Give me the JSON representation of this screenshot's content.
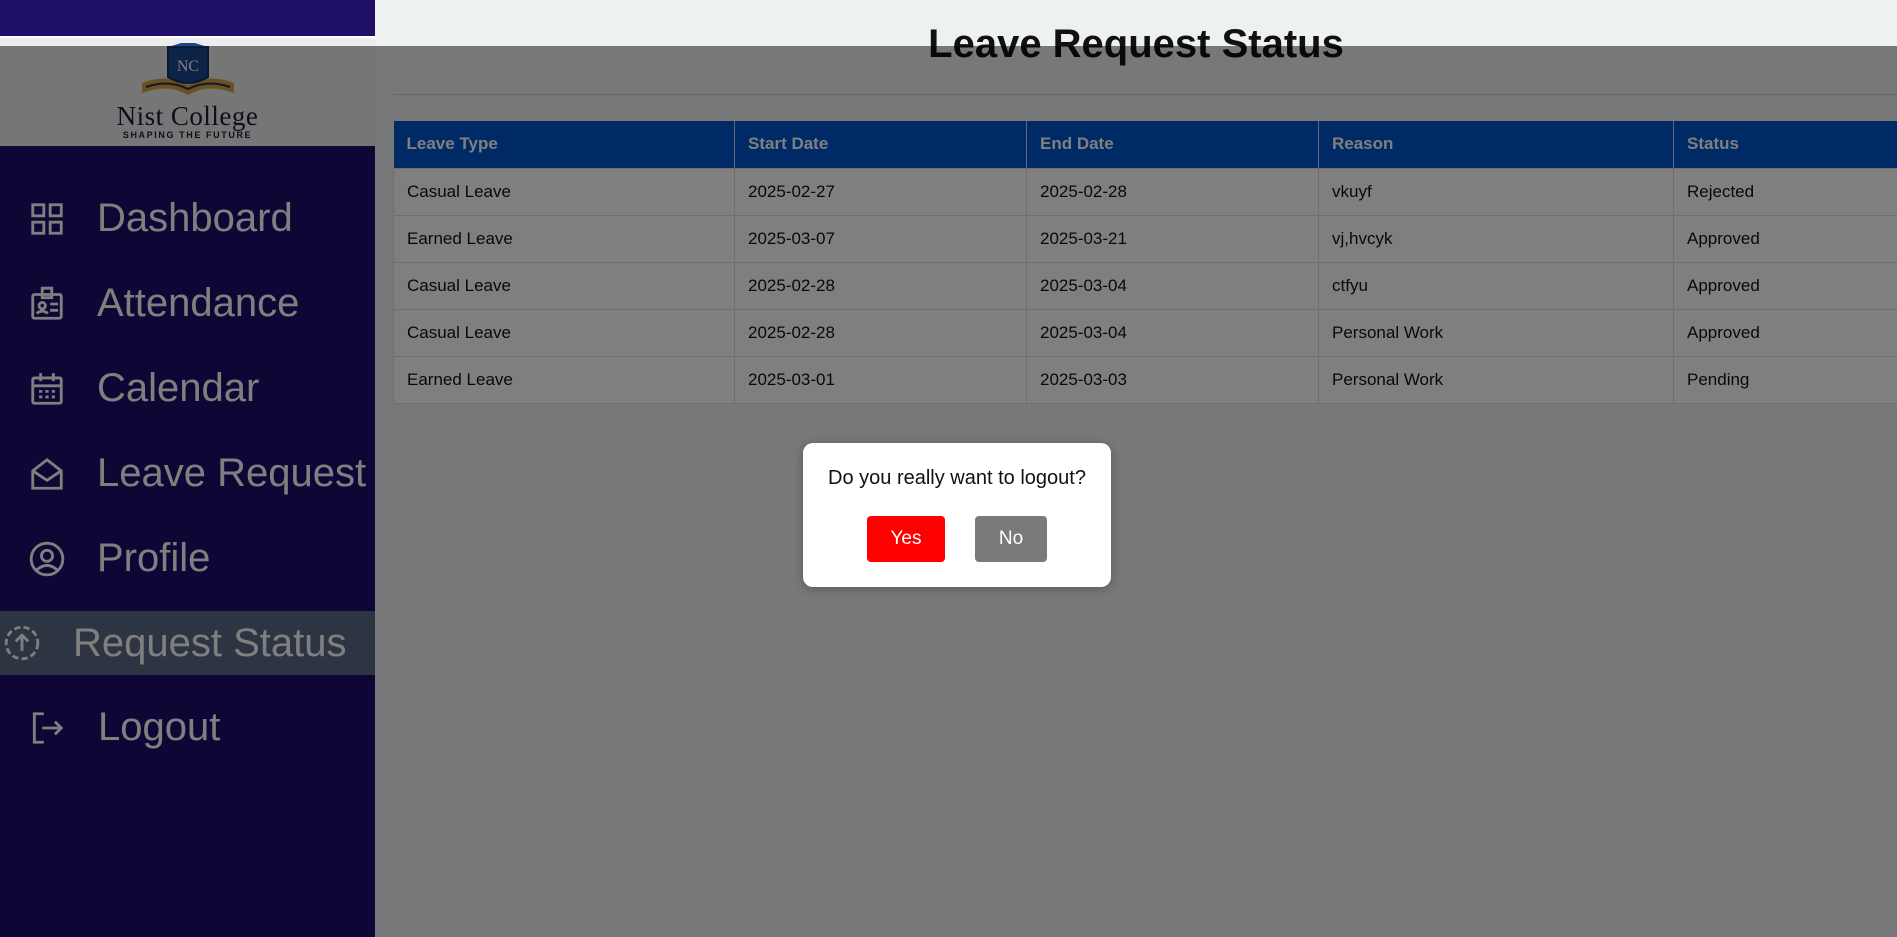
{
  "brand": {
    "logo_monogram": "NC",
    "name": "Nist College",
    "tagline": "SHAPING THE FUTURE"
  },
  "sidebar": {
    "items": [
      {
        "label": "Dashboard",
        "icon": "grid-icon"
      },
      {
        "label": "Attendance",
        "icon": "id-badge-icon"
      },
      {
        "label": "Calendar",
        "icon": "calendar-icon"
      },
      {
        "label": "Leave Request",
        "icon": "mail-open-icon"
      },
      {
        "label": "Profile",
        "icon": "user-circle-icon"
      },
      {
        "label": "Request Status",
        "icon": "upload-circle-icon",
        "active": true
      },
      {
        "label": "Logout",
        "icon": "logout-icon"
      }
    ]
  },
  "main": {
    "title": "Leave Request Status",
    "table": {
      "headers": [
        "Leave Type",
        "Start Date",
        "End Date",
        "Reason",
        "Status"
      ],
      "rows": [
        [
          "Casual Leave",
          "2025-02-27",
          "2025-02-28",
          "vkuyf",
          "Rejected"
        ],
        [
          "Earned Leave",
          "2025-03-07",
          "2025-03-21",
          "vj,hvcyk",
          "Approved"
        ],
        [
          "Casual Leave",
          "2025-02-28",
          "2025-03-04",
          "ctfyu",
          "Approved"
        ],
        [
          "Casual Leave",
          "2025-02-28",
          "2025-03-04",
          "Personal Work",
          "Approved"
        ],
        [
          "Earned Leave",
          "2025-03-01",
          "2025-03-03",
          "Personal Work",
          "Pending"
        ]
      ]
    }
  },
  "modal": {
    "message": "Do you really want to logout?",
    "yes_label": "Yes",
    "no_label": "No"
  },
  "colors": {
    "sidebar_bg": "#1d0f6b",
    "table_header_bg": "#0055cc",
    "yes_button": "#ff0000",
    "no_button": "#7a7a7a"
  }
}
